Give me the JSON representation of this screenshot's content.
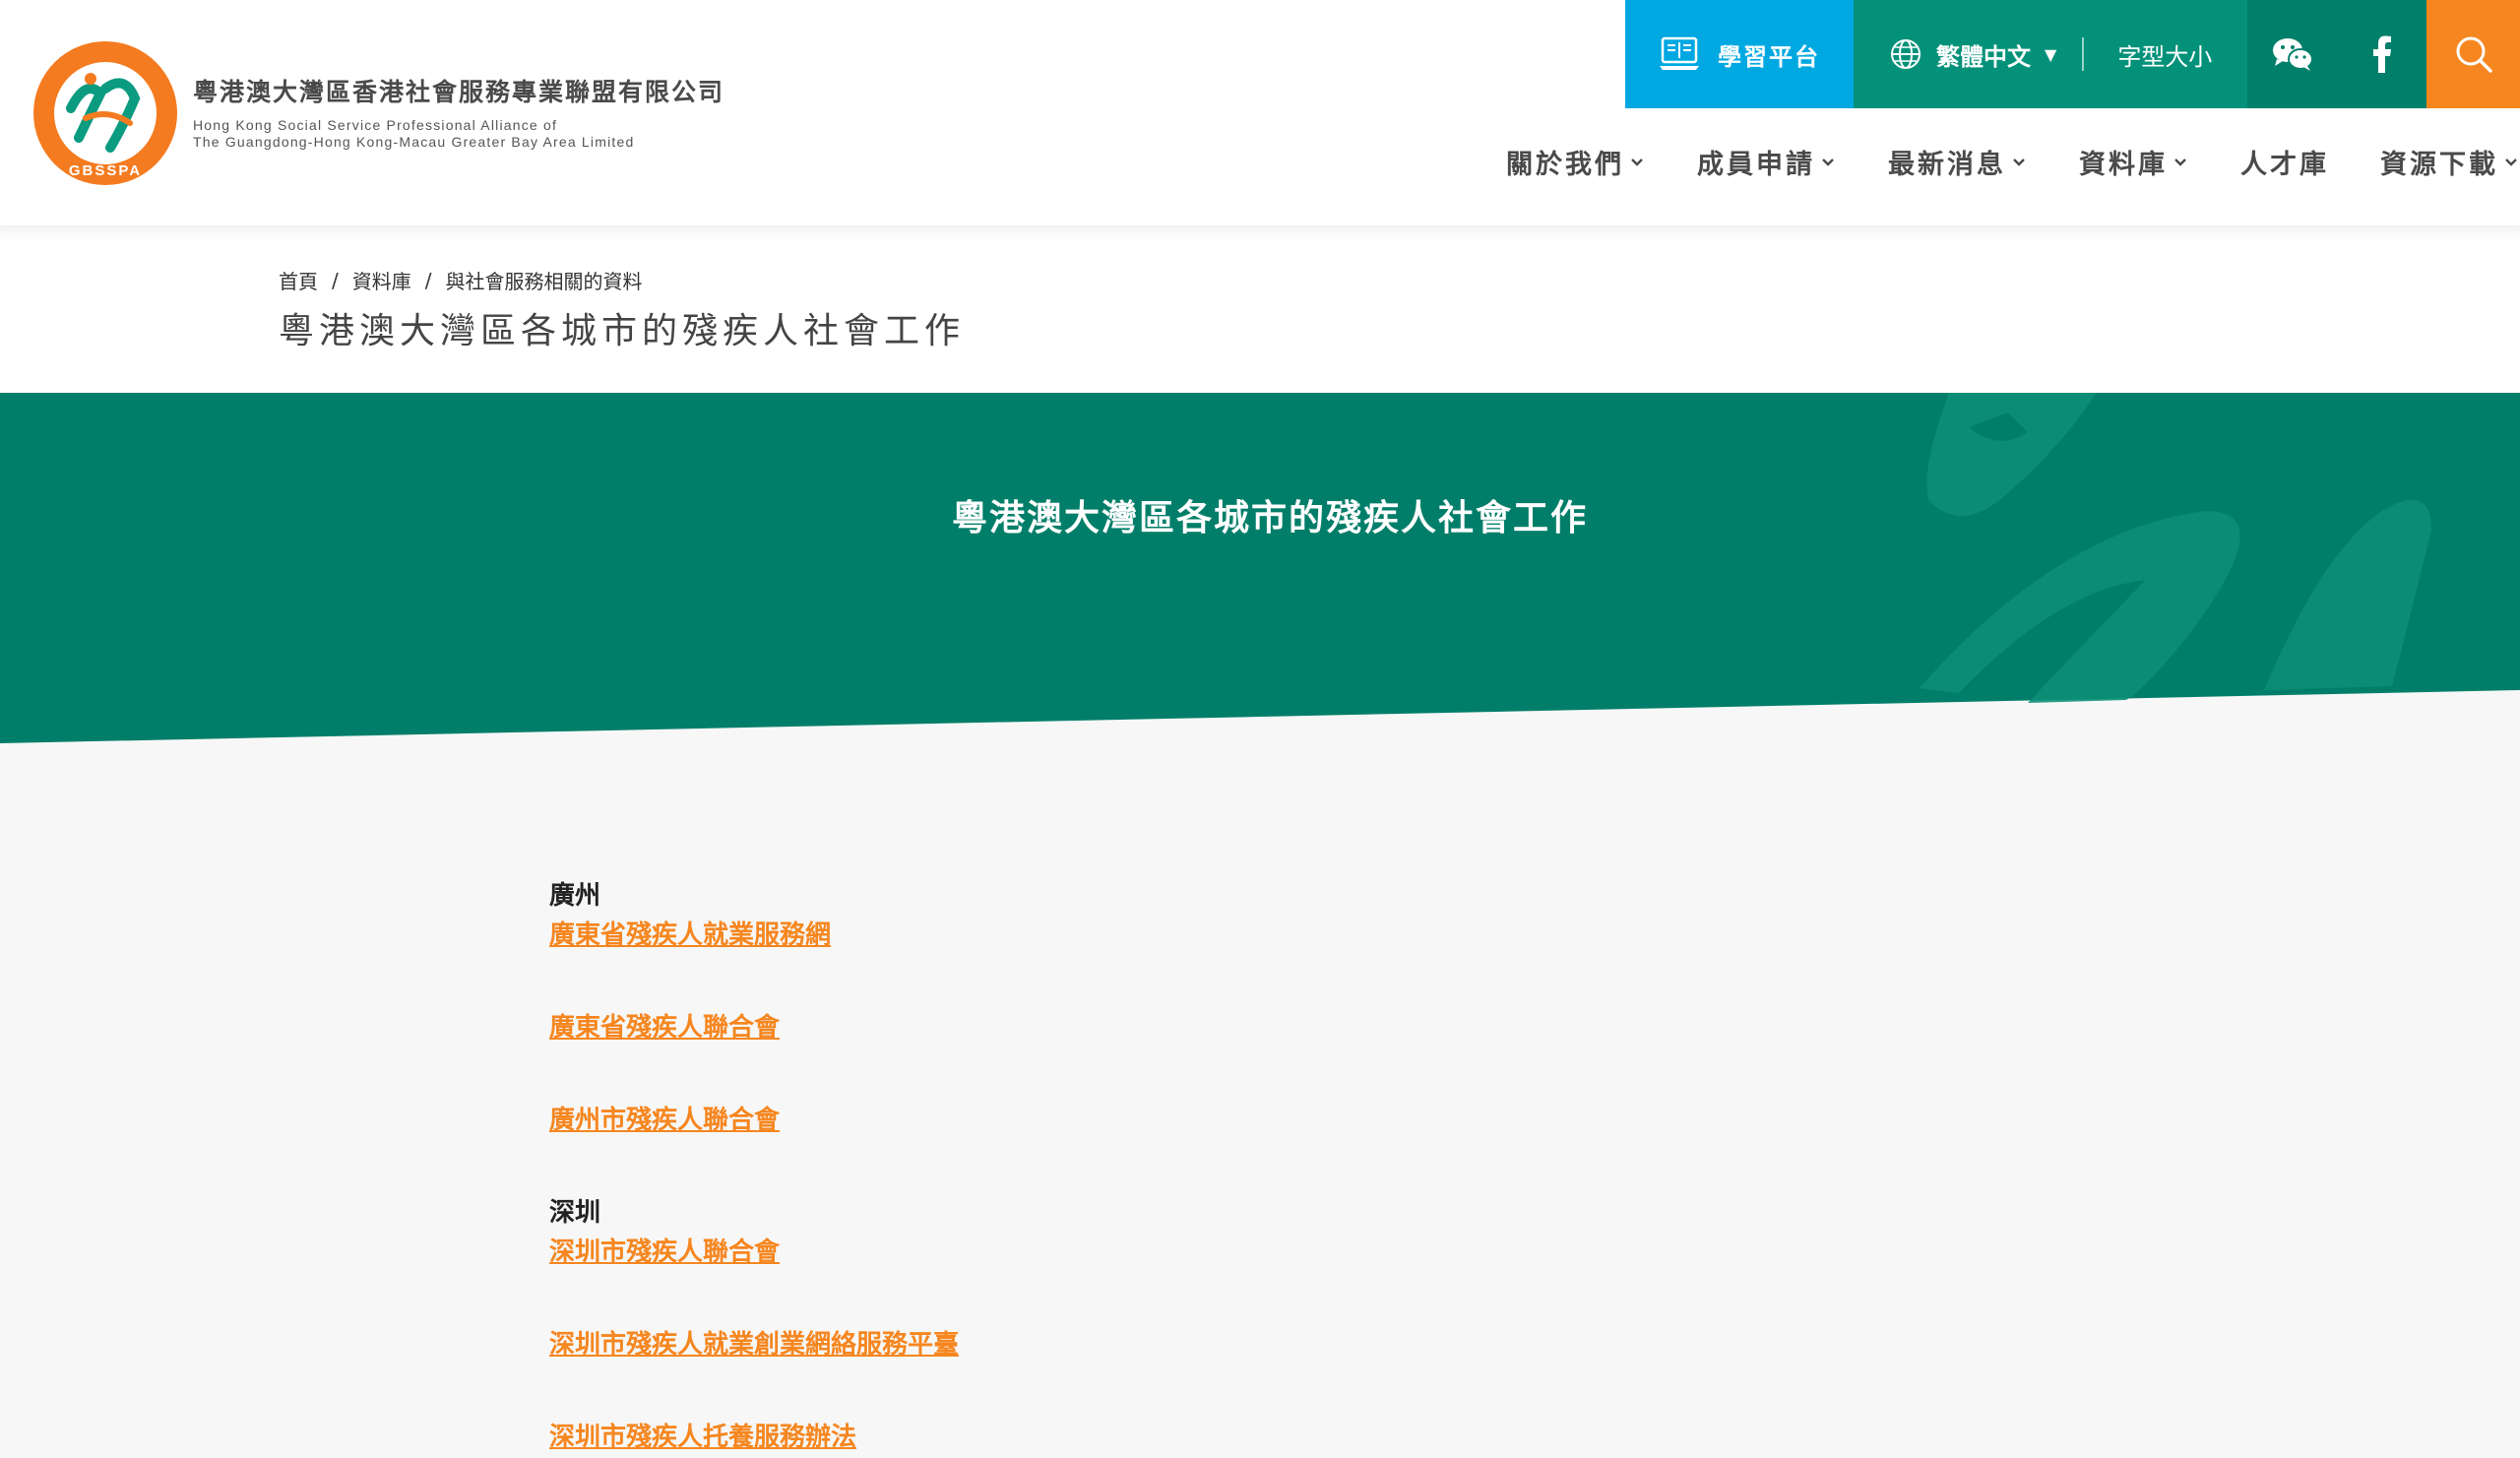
{
  "header": {
    "org_name_cn": "粵港澳大灣區香港社會服務專業聯盟有限公司",
    "org_name_en_line1": "Hong Kong Social Service Professional Alliance of",
    "org_name_en_line2": "The Guangdong-Hong Kong-Macau Greater Bay Area Limited",
    "logo_ring_text": "GBSSPA",
    "learning_platform": "學習平台",
    "language": "繁體中文",
    "font_size": "字型大小",
    "colors": {
      "learn_bg": "#00a8e2",
      "lang_bg": "#04917a",
      "social_bg": "#007f6b",
      "search_bg": "#f6861f"
    }
  },
  "nav": {
    "items": [
      {
        "label": "關於我們",
        "has_dropdown": true
      },
      {
        "label": "成員申請",
        "has_dropdown": true
      },
      {
        "label": "最新消息",
        "has_dropdown": true
      },
      {
        "label": "資料庫",
        "has_dropdown": true
      },
      {
        "label": "人才庫",
        "has_dropdown": false
      },
      {
        "label": "資源下載",
        "has_dropdown": true
      }
    ]
  },
  "breadcrumb": {
    "items": [
      "首頁",
      "資料庫",
      "與社會服務相關的資料"
    ],
    "separator": "/"
  },
  "page": {
    "title": "粵港澳大灣區各城市的殘疾人社會工作"
  },
  "banner": {
    "title": "粵港澳大灣區各城市的殘疾人社會工作",
    "color": "#017e69"
  },
  "content": {
    "sections": [
      {
        "city": "廣州",
        "links": [
          "廣東省殘疾人就業服務網",
          "廣東省殘疾人聯合會",
          "廣州市殘疾人聯合會"
        ]
      },
      {
        "city": "深圳",
        "links": [
          "深圳市殘疾人聯合會",
          "深圳市殘疾人就業創業網絡服務平臺",
          "深圳市殘疾人托養服務辦法"
        ]
      }
    ],
    "link_color": "#f6861f"
  }
}
